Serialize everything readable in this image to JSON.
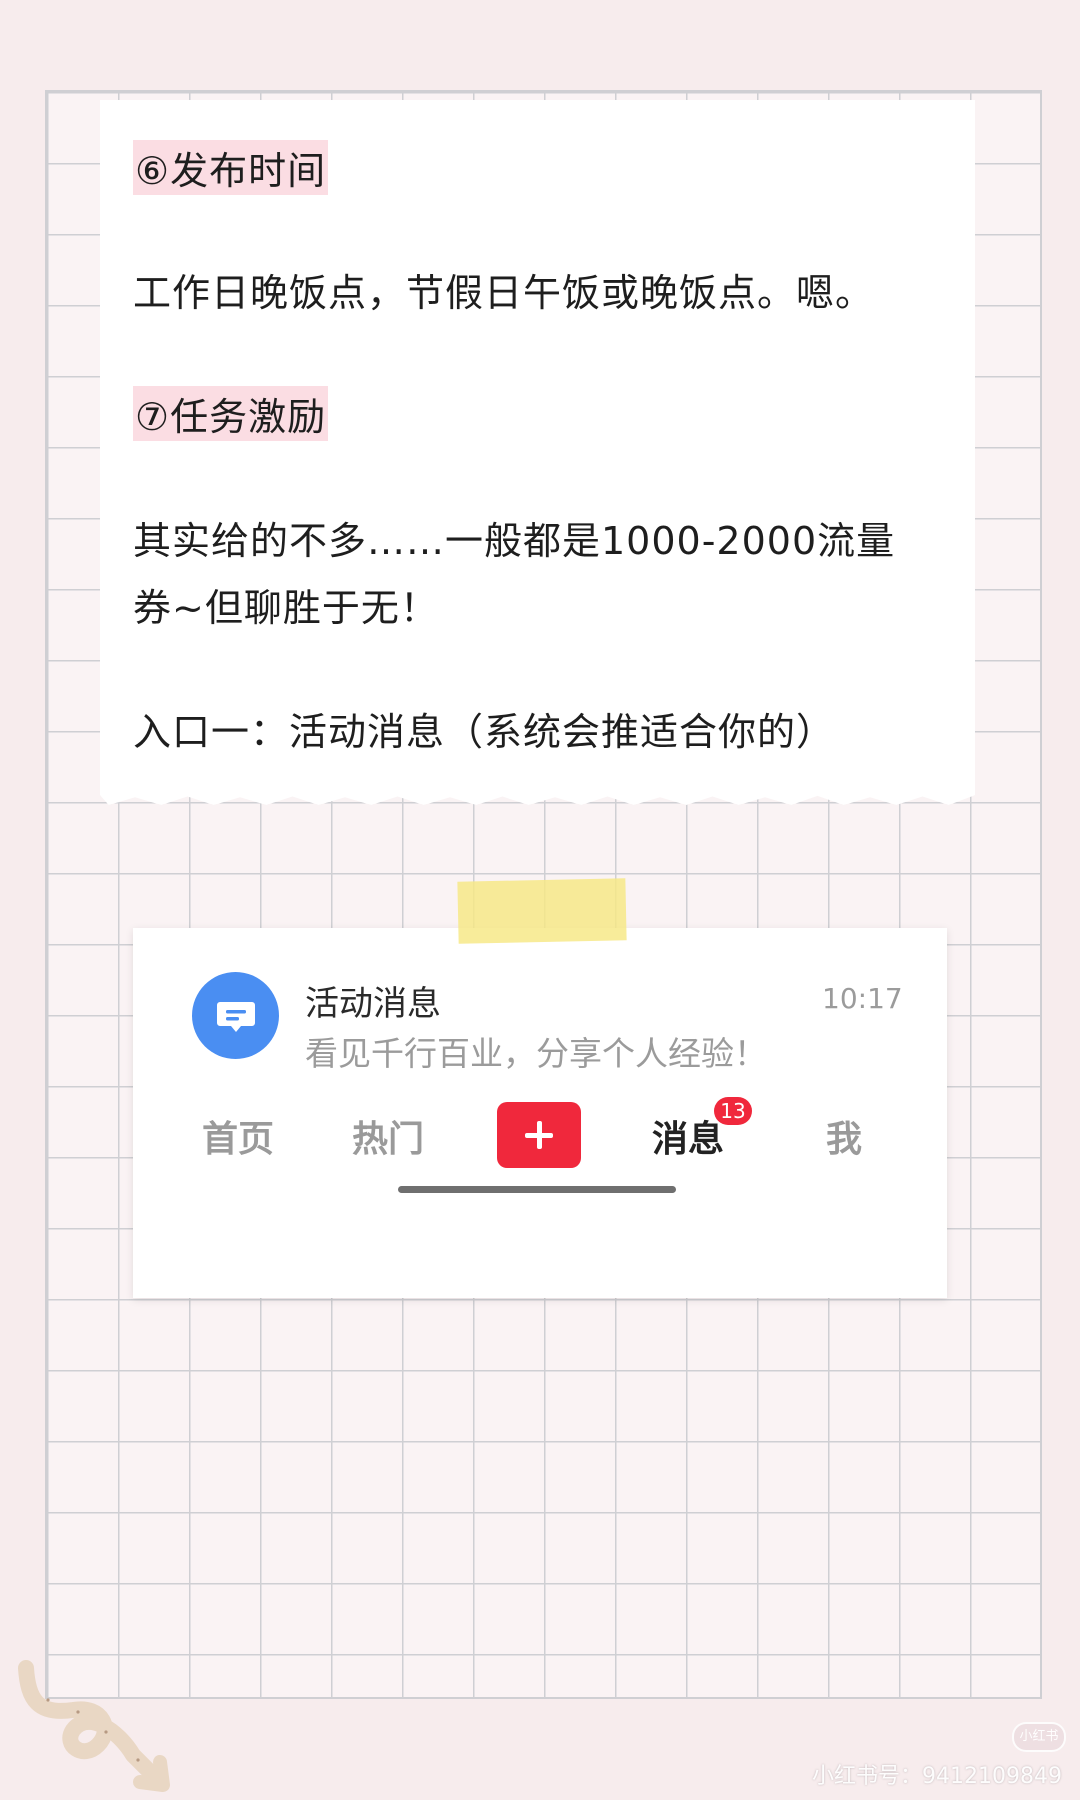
{
  "note": {
    "heading6": "⑥发布时间",
    "time_text": "工作日晚饭点，节假日午饭或晚饭点。嗯。",
    "heading7": "⑦任务激励",
    "incentive_line1": "其实给的不多……一般都是1000-2000流量",
    "incentive_line2": "券~但聊胜于无！",
    "entry_text": "入口一：活动消息（系统会推适合你的）"
  },
  "message": {
    "title": "活动消息",
    "subtitle": "看见千行百业，分享个人经验！",
    "time": "10:17",
    "icon": "chat-bubble-icon",
    "accent_color": "#4a8ef2"
  },
  "bottom_nav": {
    "home": "首页",
    "hot": "热门",
    "messages": "消息",
    "messages_badge": "13",
    "me": "我",
    "plus_color": "#f0283c"
  },
  "watermark": {
    "logo": "小红书",
    "text": "小红书号：9412109849"
  }
}
